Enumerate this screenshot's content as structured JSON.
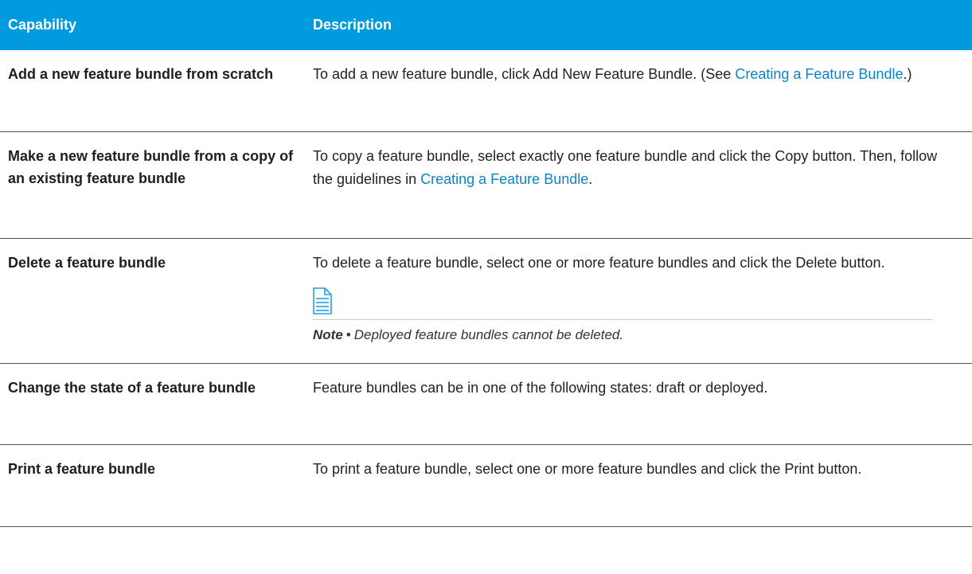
{
  "table": {
    "header": {
      "capability": "Capability",
      "description": "Description"
    },
    "rows": [
      {
        "capability": "Add a new feature bundle from scratch",
        "desc_before": "To add a new feature bundle, click Add New Feature Bundle. (See ",
        "desc_link": "Creating a Feature Bundle",
        "desc_after": ".)"
      },
      {
        "capability": "Make a new feature bundle from a copy of an existing feature bundle",
        "desc_before": "To copy a feature bundle, select exactly one feature bundle and click the Copy button. Then, follow the guidelines in ",
        "desc_link": "Creating a Feature Bundle",
        "desc_after": "."
      },
      {
        "capability": "Delete a feature bundle",
        "desc": "To delete a feature bundle, select one or more feature bundles and click the Delete button.",
        "note_label": "Note",
        "note_bullet": "•",
        "note_text": "Deployed feature bundles cannot be deleted."
      },
      {
        "capability": "Change the state of a feature bundle",
        "desc": "Feature bundles can be in one of the following states: draft or deployed."
      },
      {
        "capability": "Print a feature bundle",
        "desc": "To print a feature bundle, select one or more feature bundles and click the Print button."
      }
    ]
  },
  "colors": {
    "header_bg": "#009bde",
    "header_text": "#ffffff",
    "link": "#0d84c7",
    "note_icon": "#1aa3df"
  },
  "icons": {
    "note": "note-document-icon"
  }
}
